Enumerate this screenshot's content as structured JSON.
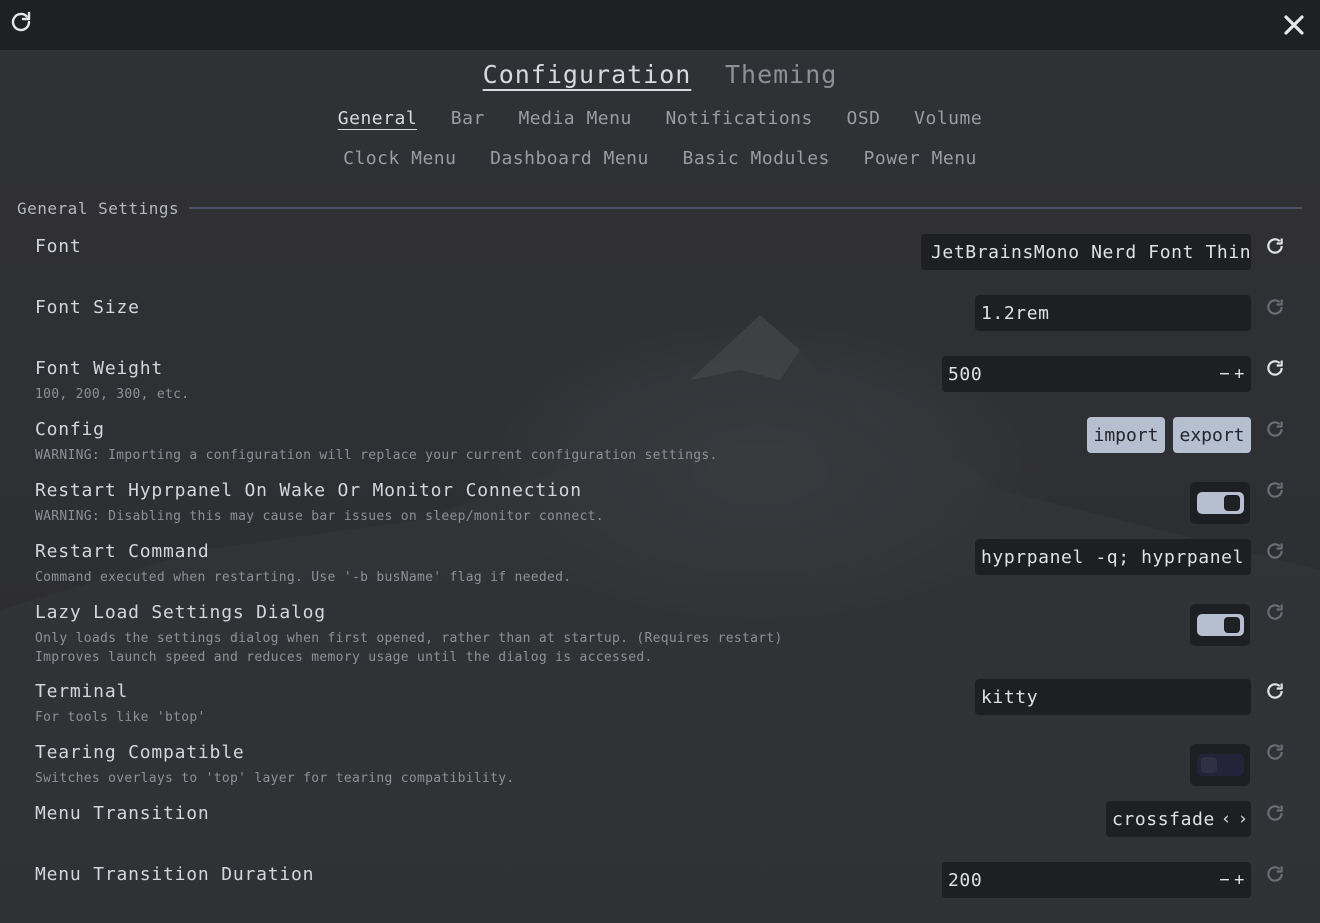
{
  "titlebar": {
    "refresh_icon": "refresh-icon",
    "close_icon": "close-icon"
  },
  "main_tabs": [
    "Configuration",
    "Theming"
  ],
  "sub_tabs_row1": [
    "General",
    "Bar",
    "Media Menu",
    "Notifications",
    "OSD",
    "Volume"
  ],
  "sub_tabs_row2": [
    "Clock Menu",
    "Dashboard Menu",
    "Basic Modules",
    "Power Menu"
  ],
  "section": {
    "title": "General Settings"
  },
  "settings": {
    "font": {
      "label": "Font",
      "value": "JetBrainsMono Nerd Font Thin"
    },
    "font_size": {
      "label": "Font Size",
      "value": "1.2rem"
    },
    "font_weight": {
      "label": "Font Weight",
      "desc": "100, 200, 300, etc.",
      "value": "500",
      "minus": "−",
      "plus": "+"
    },
    "config": {
      "label": "Config",
      "desc": "WARNING: Importing a configuration will replace your current configuration settings.",
      "import": "import",
      "export": "export"
    },
    "restart_on_wake": {
      "label": "Restart Hyprpanel On Wake Or Monitor Connection",
      "desc": "WARNING: Disabling this may cause bar issues on sleep/monitor connect.",
      "enabled": true
    },
    "restart_command": {
      "label": "Restart Command",
      "desc": "Command executed when restarting. Use '-b busName' flag if needed.",
      "value": "hyprpanel -q; hyprpanel"
    },
    "lazy_load": {
      "label": "Lazy Load Settings Dialog",
      "desc1": "Only loads the settings dialog when first opened, rather than at startup. (Requires restart)",
      "desc2": "Improves launch speed and reduces memory usage until the dialog is accessed.",
      "enabled": true
    },
    "terminal": {
      "label": "Terminal",
      "desc": "For tools like 'btop'",
      "value": "kitty"
    },
    "tearing": {
      "label": "Tearing Compatible",
      "desc": "Switches overlays to 'top' layer for tearing compatibility.",
      "enabled": false
    },
    "menu_transition": {
      "label": "Menu Transition",
      "value": "crossfade",
      "prev": "‹",
      "next": "›"
    },
    "menu_transition_duration": {
      "label": "Menu Transition Duration",
      "value": "200",
      "minus": "−",
      "plus": "+"
    }
  },
  "colors": {
    "accent": "#b5bfcf",
    "background": "#2a2b2e",
    "titlebar": "#1f2023",
    "input_bg": "#1e1f22",
    "divider": "#4d5068"
  }
}
